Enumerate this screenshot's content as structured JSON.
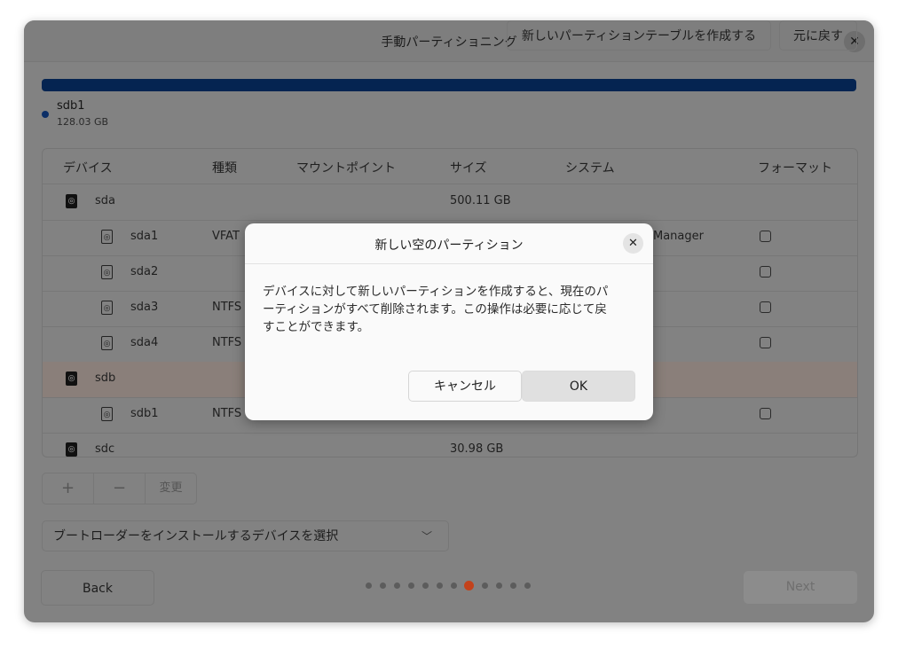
{
  "window": {
    "title": "手動パーティショニング",
    "close_glyph": "✕"
  },
  "disk_bar": {
    "legend_name": "sdb1",
    "legend_size": "128.03 GB",
    "color": "#0b2e66"
  },
  "table": {
    "headers": {
      "device": "デバイス",
      "type": "種類",
      "mount": "マウントポイント",
      "size": "サイズ",
      "system": "システム",
      "format": "フォーマット"
    },
    "rows": [
      {
        "name": "sda",
        "type": "",
        "size": "500.11 GB",
        "system": ""
      },
      {
        "name": "sda1",
        "type": "VFAT",
        "size": "",
        "system": "Manager"
      },
      {
        "name": "sda2",
        "type": "",
        "size": "",
        "system": ""
      },
      {
        "name": "sda3",
        "type": "NTFS",
        "size": "",
        "system": ""
      },
      {
        "name": "sda4",
        "type": "NTFS",
        "size": "",
        "system": ""
      },
      {
        "name": "sdb",
        "type": "",
        "size": "",
        "system": ""
      },
      {
        "name": "sdb1",
        "type": "NTFS",
        "size": "",
        "system": ""
      },
      {
        "name": "sdc",
        "type": "",
        "size": "30.98 GB",
        "system": ""
      }
    ]
  },
  "toolbar": {
    "add": "+",
    "remove": "−",
    "change": "変更",
    "new_table": "新しいパーティションテーブルを作成する",
    "revert": "元に戻す"
  },
  "bootloader": {
    "placeholder": "ブートローダーをインストールするデバイスを選択",
    "chevron": "﹀"
  },
  "nav": {
    "back": "Back",
    "next": "Next",
    "page_count": 12,
    "current_page": 8
  },
  "dialog": {
    "title": "新しい空のパーティション",
    "close_glyph": "✕",
    "message_line1": "デバイスに対して新しいパーティションを作成すると、現在のパ",
    "message_line2": "ーティションがすべて削除されます。この操作は必要に応じて戻",
    "message_line3": "すことができます。",
    "cancel": "キャンセル",
    "ok": "OK"
  },
  "colors": {
    "accent_dot": "#c3421b",
    "progress": "#052451"
  }
}
